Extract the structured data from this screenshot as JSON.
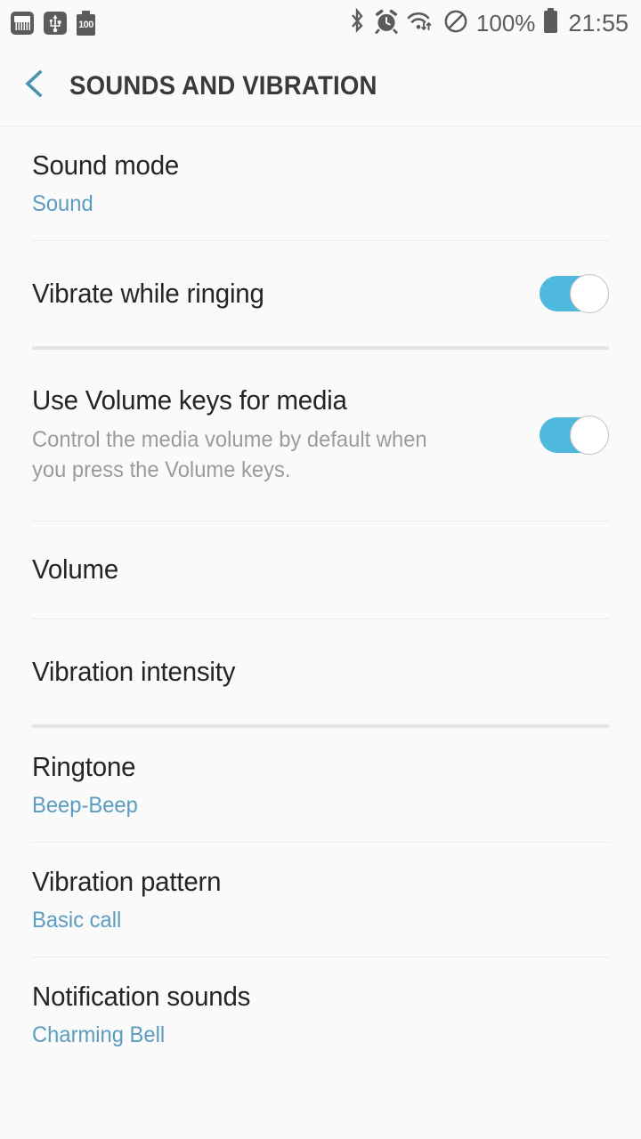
{
  "status_bar": {
    "left_icons": [
      {
        "name": "gallery-icon",
        "label": "gallery"
      },
      {
        "name": "usb-icon",
        "label": "usb"
      },
      {
        "name": "battery-saver-icon",
        "label": "100"
      }
    ],
    "right_icons": [
      {
        "name": "bluetooth-icon",
        "glyph": "ᛗ"
      },
      {
        "name": "alarm-icon",
        "glyph": "⏰"
      },
      {
        "name": "wifi-transfer-icon",
        "glyph": "wifi"
      },
      {
        "name": "do-not-disturb-icon",
        "glyph": "⃠"
      }
    ],
    "battery_percent": "100%",
    "clock": "21:55"
  },
  "header": {
    "back_label": "Back",
    "title": "SOUNDS AND VIBRATION",
    "accent_color": "#4a93b0"
  },
  "theme": {
    "background": "#fafafa",
    "accent": "#4fb9dd",
    "value_text": "#5b9cc0",
    "title_text": "#252525",
    "description_text": "#9b9b9b",
    "divider": "#ececec",
    "section_divider": "#e5e5e5"
  },
  "settings": {
    "items": [
      {
        "id": "sound-mode",
        "title": "Sound mode",
        "value": "Sound",
        "description": null,
        "toggle": null,
        "separator_after": "thin"
      },
      {
        "id": "vibrate-while-ringing",
        "title": "Vibrate while ringing",
        "value": null,
        "description": null,
        "toggle": "on",
        "separator_after": "thick"
      },
      {
        "id": "use-volume-keys-for-media",
        "title": "Use Volume keys for media",
        "value": null,
        "description": "Control the media volume by default when you press the Volume keys.",
        "toggle": "on",
        "separator_after": "thin"
      },
      {
        "id": "volume",
        "title": "Volume",
        "value": null,
        "description": null,
        "toggle": null,
        "separator_after": "thin"
      },
      {
        "id": "vibration-intensity",
        "title": "Vibration intensity",
        "value": null,
        "description": null,
        "toggle": null,
        "separator_after": "thick"
      },
      {
        "id": "ringtone",
        "title": "Ringtone",
        "value": "Beep-Beep",
        "description": null,
        "toggle": null,
        "separator_after": "thin"
      },
      {
        "id": "vibration-pattern",
        "title": "Vibration pattern",
        "value": "Basic call",
        "description": null,
        "toggle": null,
        "separator_after": "thin"
      },
      {
        "id": "notification-sounds",
        "title": "Notification sounds",
        "value": "Charming Bell",
        "description": null,
        "toggle": null,
        "separator_after": null
      }
    ]
  }
}
